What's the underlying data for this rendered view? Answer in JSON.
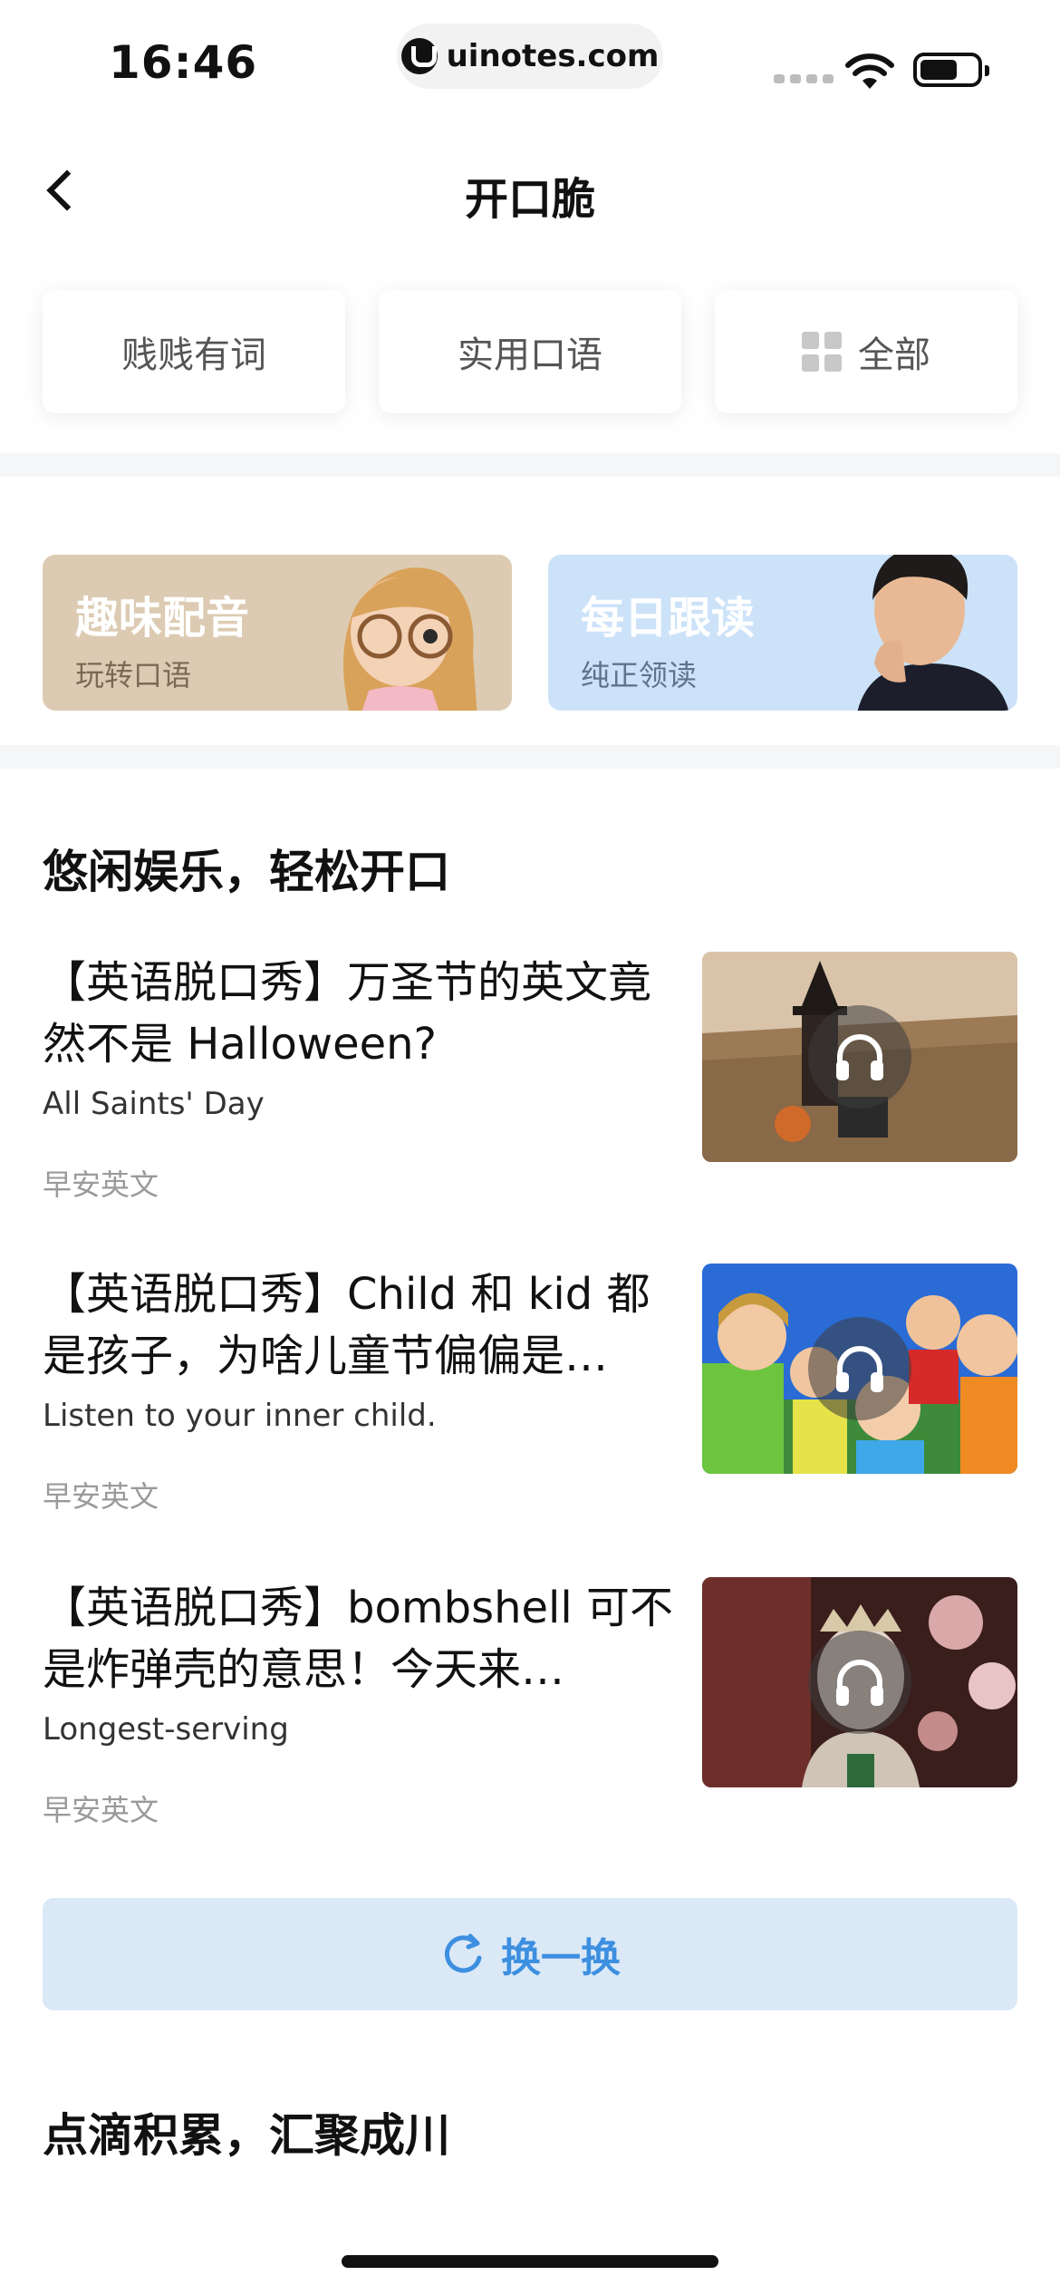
{
  "status_bar": {
    "time": "16:46",
    "url": "uinotes.com"
  },
  "nav": {
    "title": "开口脆"
  },
  "chips": [
    "贱贱有词",
    "实用口语",
    "全部"
  ],
  "banners": [
    {
      "title": "趣味配音",
      "subtitle": "玩转口语"
    },
    {
      "title": "每日跟读",
      "subtitle": "纯正领读"
    }
  ],
  "section1": {
    "title": "悠闲娱乐，轻松开口"
  },
  "articles": [
    {
      "title": "【英语脱口秀】万圣节的英文竟然不是 Halloween?",
      "subtitle": "All Saints' Day",
      "source": "早安英文"
    },
    {
      "title": "【英语脱口秀】Child 和 kid 都是孩子，为啥儿童节偏偏是…",
      "subtitle": "Listen to your inner child.",
      "source": "早安英文"
    },
    {
      "title": "【英语脱口秀】bombshell 可不是炸弹壳的意思！今天来…",
      "subtitle": "Longest-serving",
      "source": "早安英文"
    }
  ],
  "refresh_button": {
    "label": "换一换"
  },
  "section2": {
    "title": "点滴积累，汇聚成川"
  },
  "colors": {
    "accent": "#3d8fe0",
    "refresh_bg": "#dbe9f6",
    "banner_fun": "#dccbb2",
    "banner_daily": "#cce2f9"
  }
}
